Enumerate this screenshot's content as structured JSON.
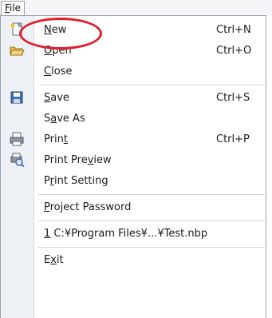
{
  "menubar": {
    "file_tab": {
      "label": "File",
      "accel": "F",
      "rest": "ile"
    }
  },
  "menu": {
    "items": [
      {
        "id": "new",
        "pre": "",
        "accel": "N",
        "post": "ew",
        "shortcut": "Ctrl+N",
        "icon": "new-document-icon"
      },
      {
        "id": "open",
        "pre": "",
        "accel": "O",
        "post": "pen",
        "shortcut": "Ctrl+O",
        "icon": "open-folder-icon"
      },
      {
        "id": "close",
        "pre": "",
        "accel": "C",
        "post": "lose",
        "shortcut": "",
        "icon": ""
      },
      {
        "id": "save",
        "pre": "",
        "accel": "S",
        "post": "ave",
        "shortcut": "Ctrl+S",
        "icon": "save-floppy-icon"
      },
      {
        "id": "save-as",
        "pre": "S",
        "accel": "a",
        "post": "ve As",
        "shortcut": "",
        "icon": ""
      },
      {
        "id": "print",
        "pre": "Prin",
        "accel": "t",
        "post": "",
        "shortcut": "Ctrl+P",
        "icon": "printer-icon"
      },
      {
        "id": "print-preview",
        "pre": "Print Pre",
        "accel": "v",
        "post": "iew",
        "shortcut": "",
        "icon": "print-preview-icon"
      },
      {
        "id": "print-setting",
        "pre": "P",
        "accel": "r",
        "post": "int Setting",
        "shortcut": "",
        "icon": ""
      },
      {
        "id": "project-password",
        "pre": "",
        "accel": "P",
        "post": "roject Password",
        "shortcut": "",
        "icon": ""
      },
      {
        "id": "recent-1",
        "pre": "",
        "accel": "1",
        "post": " C:¥Program Files¥...¥Test.nbp",
        "shortcut": "",
        "icon": ""
      },
      {
        "id": "exit",
        "pre": "E",
        "accel": "x",
        "post": "it",
        "shortcut": "",
        "icon": ""
      }
    ]
  },
  "colors": {
    "highlight_ring": "#e11e2a",
    "icon_strip": "#eef1f5",
    "border": "#9aa3ad"
  }
}
